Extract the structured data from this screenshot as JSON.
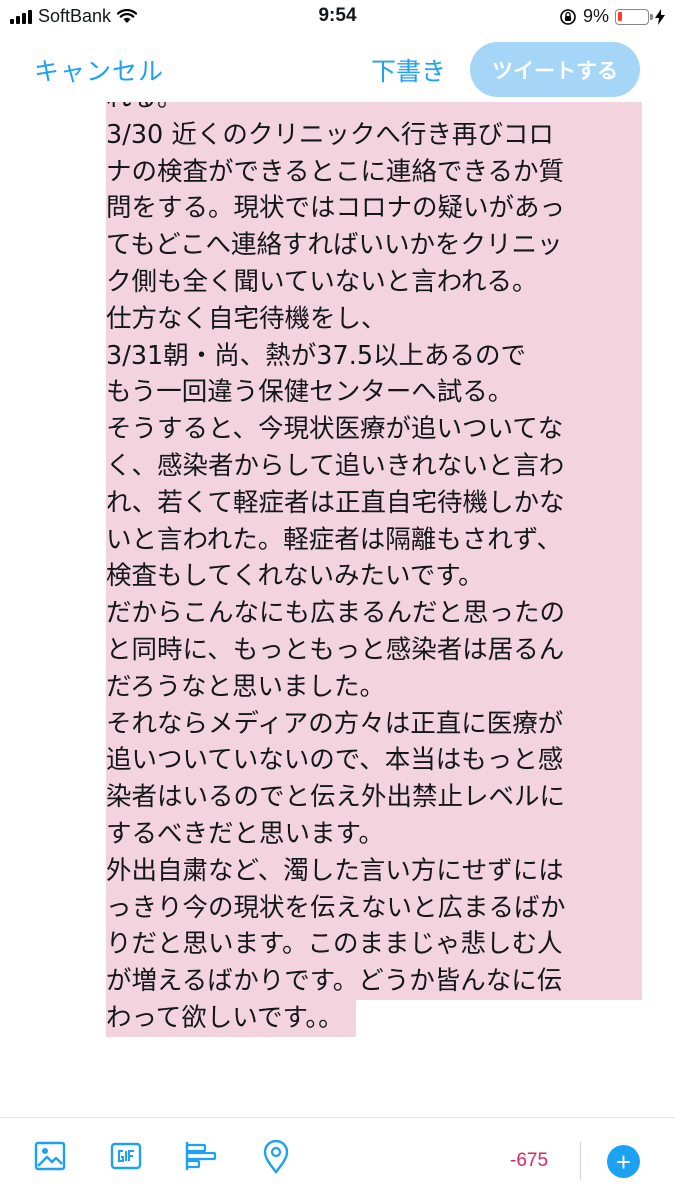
{
  "status": {
    "carrier": "SoftBank",
    "time": "9:54",
    "battery": "9%"
  },
  "nav": {
    "cancel": "キャンセル",
    "draft": "下書き",
    "tweet": "ツイートする"
  },
  "tweet": {
    "lines": [
      "れる。",
      "3/30 近くのクリニックへ行き再びコロ",
      "ナの検査ができるとこに連絡できるか質",
      "問をする。現状ではコロナの疑いがあっ",
      "てもどこへ連絡すればいいかをクリニッ",
      "ク側も全く聞いていないと言われる。",
      "仕方なく自宅待機をし、",
      "3/31朝・尚、熱が37.5以上あるので",
      "もう一回違う保健センターへ試る。",
      "そうすると、今現状医療が追いついてな",
      "く、感染者からして追いきれないと言わ",
      "れ、若くて軽症者は正直自宅待機しかな",
      "いと言われた。軽症者は隔離もされず、",
      "検査もしてくれないみたいです。",
      "だからこんなにも広まるんだと思ったの",
      "と同時に、もっともっと感染者は居るん",
      "だろうなと思いました。",
      "それならメディアの方々は正直に医療が",
      "追いついていないので、本当はもっと感",
      "染者はいるのでと伝え外出禁止レベルに",
      "するべきだと思います。",
      "外出自粛など、濁した言い方にせずには",
      "っきり今の現状を伝えないと広まるばか",
      "りだと思います。このままじゃ悲しむ人",
      "が増えるばかりです。どうか皆んなに伝",
      "わって欲しいです。。"
    ]
  },
  "toolbar": {
    "counter": "-675",
    "add": "+"
  },
  "colors": {
    "accent": "#1da1f2",
    "tweet_button_disabled": "#a5d6f8",
    "highlight": "#f3d4de",
    "counter_over": "#e0245e"
  }
}
